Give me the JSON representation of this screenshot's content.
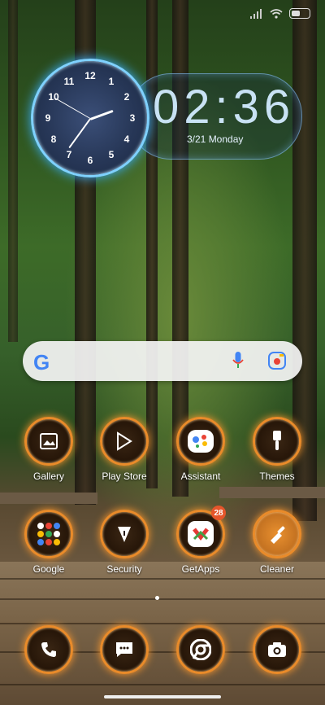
{
  "status": {
    "icons": [
      "signal-icon",
      "wifi-icon",
      "battery-icon"
    ]
  },
  "clock": {
    "time": "02:36",
    "date": "3/21 Monday",
    "dial_numbers": [
      "12",
      "1",
      "2",
      "3",
      "4",
      "5",
      "6",
      "7",
      "8",
      "9",
      "10",
      "11"
    ]
  },
  "search": {
    "icons": [
      "google-logo",
      "mic-icon",
      "lens-icon"
    ]
  },
  "apps_row1": [
    {
      "label": "Gallery"
    },
    {
      "label": "Play Store"
    },
    {
      "label": "Assistant"
    },
    {
      "label": "Themes"
    }
  ],
  "apps_row2": [
    {
      "label": "Google"
    },
    {
      "label": "Security"
    },
    {
      "label": "GetApps",
      "badge": "28"
    },
    {
      "label": "Cleaner"
    }
  ],
  "dock": [
    "phone-icon",
    "messages-icon",
    "chrome-icon",
    "camera-icon"
  ],
  "colors": {
    "accent_glow": "#ff9a2e",
    "clock_glow": "#3ab0ff",
    "badge": "#e5552b"
  }
}
